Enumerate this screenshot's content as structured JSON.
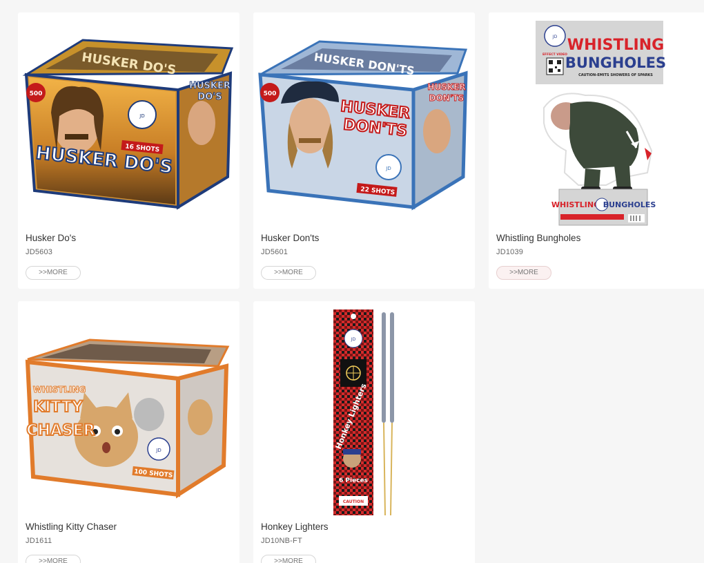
{
  "products": [
    {
      "name": "Husker Do's",
      "code": "JD5603",
      "more_label": ">>MORE",
      "image": {
        "title": "HUSKER DO'S",
        "badge": "500",
        "shots": "16 SHOTS",
        "primary_color": "#e9a43a",
        "secondary_color": "#1e3b7a"
      }
    },
    {
      "name": "Husker Don'ts",
      "code": "JD5601",
      "more_label": ">>MORE",
      "image": {
        "title_line1": "HUSKER",
        "title_line2": "DON'TS",
        "badge": "500",
        "shots": "22 SHOTS",
        "primary_color": "#c9d6e6",
        "secondary_color": "#3a73b8"
      }
    },
    {
      "name": "Whistling Bungholes",
      "code": "JD1039",
      "more_label": ">>MORE",
      "image": {
        "title_line1": "WHISTLING",
        "title_line2": "BUNGHOLES",
        "effect_video": "EFFECT VIDEO",
        "caution": "CAUTION-EMITS SHOWERS OF SPARKS",
        "small_title_left": "WHISTLING",
        "small_title_right": "BUNGHOLES",
        "primary_color": "#d8232a",
        "secondary_color": "#2b3f8f"
      }
    },
    {
      "name": "Whistling Kitty Chaser",
      "code": "JD1611",
      "more_label": ">>MORE",
      "image": {
        "title_line1": "WHISTLING",
        "title_line2": "KITTY",
        "title_line3": "CHASER",
        "shots": "100 SHOTS",
        "primary_color": "#e17b2b",
        "secondary_color": "#7a4a1f"
      }
    },
    {
      "name": "Honkey Lighters",
      "code": "JD10NB-FT",
      "more_label": ">>MORE",
      "image": {
        "title": "Honkey Lighters",
        "pieces": "6 Pieces",
        "caution": "CAUTION",
        "primary_color": "#d52b2b",
        "secondary_color": "#1a1a1a"
      }
    }
  ]
}
